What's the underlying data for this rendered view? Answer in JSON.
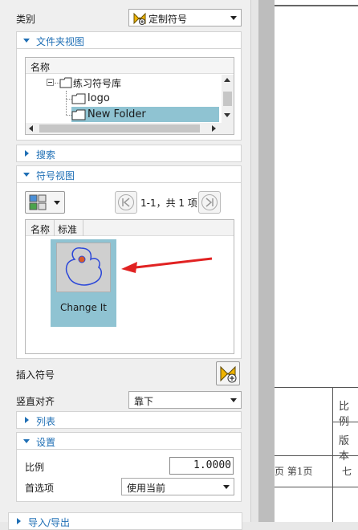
{
  "category": {
    "label": "类别",
    "selected": "定制符号"
  },
  "folder_view": {
    "title": "文件夹视图",
    "column_header": "名称",
    "tree": [
      {
        "label": "练习符号库"
      },
      {
        "label": "logo"
      },
      {
        "label": "New Folder"
      }
    ]
  },
  "search": {
    "title": "搜索"
  },
  "symbol_view": {
    "title": "符号视图",
    "pager_text": "1-1，共 1 项",
    "columns": [
      "名称",
      "标准"
    ],
    "items": [
      {
        "label": "Change It"
      }
    ]
  },
  "insert_symbol": {
    "label": "插入符号"
  },
  "vertical_align": {
    "label": "竖直对齐",
    "selected": "靠下"
  },
  "list_section": {
    "title": "列表"
  },
  "settings": {
    "title": "设置",
    "scale_label": "比例",
    "scale_value": "1.0000",
    "preference_label": "首选项",
    "preference_value": "使用当前"
  },
  "import_export": {
    "title": "导入/导出"
  },
  "drawing": {
    "cells": [
      "比例",
      "版本",
      "页 第1页",
      "七"
    ]
  },
  "colors": {
    "accent": "#1f6fb5",
    "selection": "#8fc3d2",
    "symbol_stroke": "#2b47d9"
  },
  "icons": [
    "symbol-library-icon",
    "insert-symbol-icon",
    "first-page-icon",
    "last-page-icon",
    "view-mode-icon"
  ]
}
